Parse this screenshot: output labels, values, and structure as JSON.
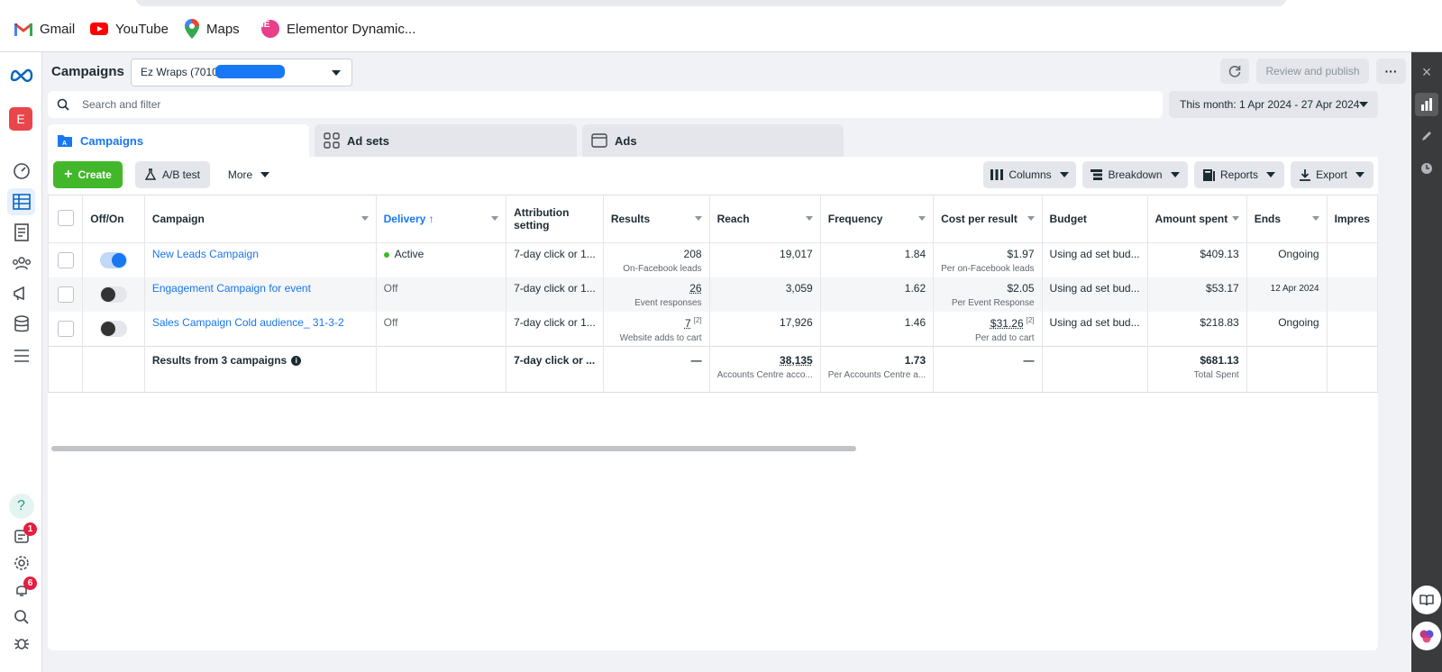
{
  "bookmarks": [
    {
      "label": "Gmail",
      "icon": "gmail-icon"
    },
    {
      "label": "YouTube",
      "icon": "youtube-icon"
    },
    {
      "label": "Maps",
      "icon": "maps-icon"
    },
    {
      "label": "Elementor Dynamic...",
      "icon": "elementor-icon"
    }
  ],
  "rail": {
    "avatar": "E",
    "requests_badge": "1",
    "notifications_badge": "6",
    "help": "?"
  },
  "header": {
    "title": "Campaigns",
    "account": "Ez Wraps (70101",
    "publish_label": "Review and publish",
    "more_label": "···"
  },
  "search": {
    "placeholder": "Search and filter",
    "date_range": "This month: 1 Apr 2024 - 27 Apr 2024"
  },
  "tabs": [
    {
      "label": "Campaigns",
      "active": true
    },
    {
      "label": "Ad sets",
      "active": false
    },
    {
      "label": "Ads",
      "active": false
    }
  ],
  "toolbar": {
    "create": "Create",
    "ab_test": "A/B test",
    "more": "More",
    "columns": "Columns",
    "breakdown": "Breakdown",
    "reports": "Reports",
    "export": "Export"
  },
  "table": {
    "headers": {
      "toggle": "Off/On",
      "campaign": "Campaign",
      "delivery": "Delivery",
      "attribution": "Attribution setting",
      "results": "Results",
      "reach": "Reach",
      "frequency": "Frequency",
      "cpr": "Cost per result",
      "budget": "Budget",
      "spent": "Amount spent",
      "ends": "Ends",
      "impressions": "Impres"
    },
    "rows": [
      {
        "on": true,
        "campaign": "New Leads Campaign",
        "delivery": "Active",
        "attribution": "7-day click or 1...",
        "results": "208",
        "results_sub": "On-Facebook leads",
        "reach": "19,017",
        "frequency": "1.84",
        "cpr": "$1.97",
        "cpr_sub": "Per on-Facebook leads",
        "budget": "Using ad set bud...",
        "spent": "$409.13",
        "ends": "Ongoing"
      },
      {
        "on": false,
        "campaign": "Engagement Campaign for event",
        "delivery": "Off",
        "attribution": "7-day click or 1...",
        "results": "26",
        "results_sub": "Event responses",
        "reach": "3,059",
        "frequency": "1.62",
        "cpr": "$2.05",
        "cpr_sub": "Per Event Response",
        "budget": "Using ad set bud...",
        "spent": "$53.17",
        "ends": "12 Apr 2024"
      },
      {
        "on": false,
        "campaign": "Sales Campaign Cold audience_ 31-3-2",
        "delivery": "Off",
        "attribution": "7-day click or 1...",
        "results": "7",
        "results_sup": "[2]",
        "results_sub": "Website adds to cart",
        "reach": "17,926",
        "frequency": "1.46",
        "cpr": "$31.26",
        "cpr_sup": "[2]",
        "cpr_sub": "Per add to cart",
        "budget": "Using ad set bud...",
        "spent": "$218.83",
        "ends": "Ongoing"
      }
    ],
    "totals": {
      "label": "Results from 3 campaigns",
      "attribution": "7-day click or ...",
      "results": "—",
      "reach": "38,135",
      "reach_sub": "Accounts Centre acco...",
      "frequency": "1.73",
      "frequency_sub": "Per Accounts Centre a...",
      "cpr": "—",
      "spent": "$681.13",
      "spent_sub": "Total Spent"
    }
  },
  "colors": {
    "brand_blue": "#1877f2",
    "create_green": "#42b72a",
    "badge_red": "#e41e3f"
  }
}
